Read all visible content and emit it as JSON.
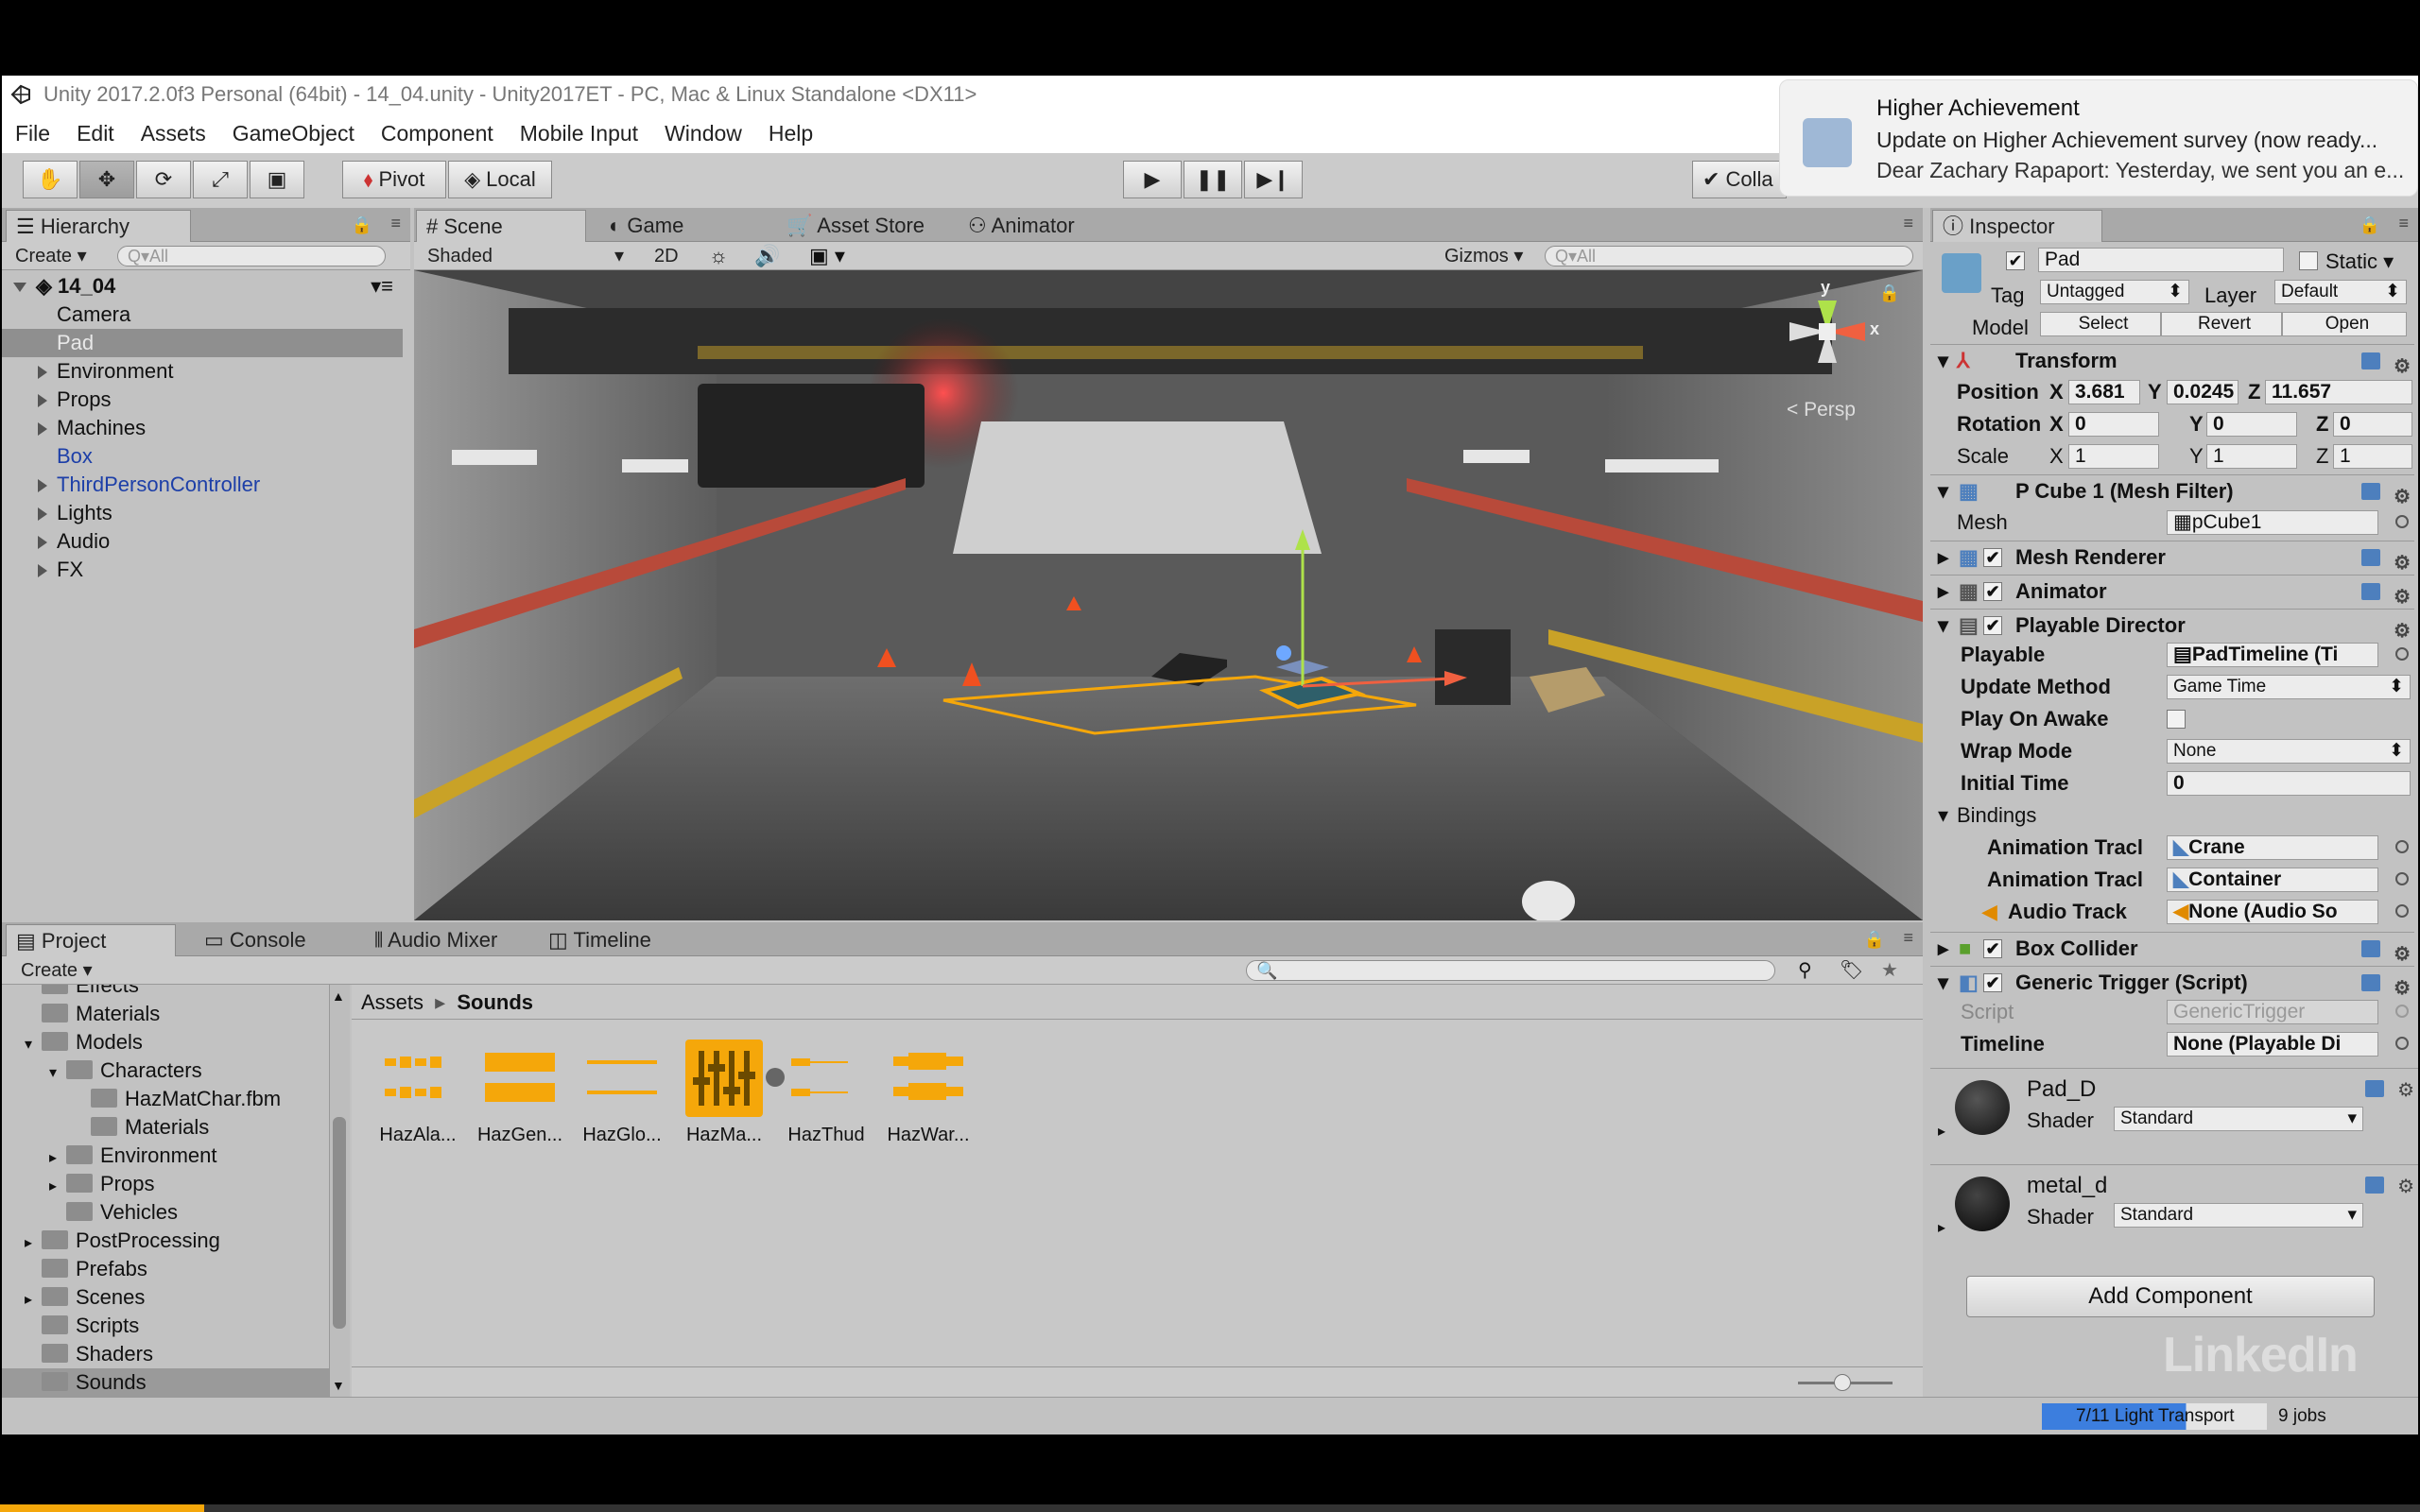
{
  "window": {
    "title": "Unity 2017.2.0f3 Personal (64bit) - 14_04.unity - Unity2017ET - PC, Mac & Linux Standalone <DX11>"
  },
  "menu": [
    "File",
    "Edit",
    "Assets",
    "GameObject",
    "Component",
    "Mobile Input",
    "Window",
    "Help"
  ],
  "toolbar": {
    "pivot": "Pivot",
    "local": "Local",
    "collab": "Colla"
  },
  "notification": {
    "title": "Higher Achievement",
    "subject": "Update on Higher Achievement survey (now ready...",
    "body": "Dear Zachary Rapaport: Yesterday, we sent you an e..."
  },
  "hierarchy": {
    "tab": "Hierarchy",
    "create": "Create",
    "search_placeholder": "Q▾All",
    "scene": "14_04",
    "items": [
      {
        "label": "Camera"
      },
      {
        "label": "Pad"
      },
      {
        "label": "Environment"
      },
      {
        "label": "Props"
      },
      {
        "label": "Machines"
      },
      {
        "label": "Box"
      },
      {
        "label": "ThirdPersonController"
      },
      {
        "label": "Lights"
      },
      {
        "label": "Audio"
      },
      {
        "label": "FX"
      }
    ]
  },
  "scene": {
    "tabs": [
      "Scene",
      "Game",
      "Asset Store",
      "Animator"
    ],
    "shading": "Shaded",
    "mode2d": "2D",
    "gizmos": "Gizmos",
    "search_placeholder": "Q▾All",
    "persp": "Persp",
    "axis_y": "y",
    "axis_x": "x"
  },
  "inspector": {
    "tab": "Inspector",
    "object_name": "Pad",
    "static": "Static",
    "tag_label": "Tag",
    "tag_value": "Untagged",
    "layer_label": "Layer",
    "layer_value": "Default",
    "model_label": "Model",
    "model_buttons": [
      "Select",
      "Revert",
      "Open"
    ],
    "transform": {
      "title": "Transform",
      "position_label": "Position",
      "rotation_label": "Rotation",
      "scale_label": "Scale",
      "position": [
        "3.681",
        "0.0245",
        "11.657"
      ],
      "rotation": [
        "0",
        "0",
        "0"
      ],
      "scale": [
        "1",
        "1",
        "1"
      ],
      "axes": [
        "X",
        "Y",
        "Z"
      ]
    },
    "mesh_filter": {
      "title": "P Cube 1 (Mesh Filter)",
      "mesh_label": "Mesh",
      "mesh_value": "pCube1"
    },
    "mesh_renderer": "Mesh Renderer",
    "animator": "Animator",
    "playable_director": {
      "title": "Playable Director",
      "playable_label": "Playable",
      "playable_value": "PadTimeline (Ti",
      "update_label": "Update Method",
      "update_value": "Game Time",
      "awake_label": "Play On Awake",
      "wrap_label": "Wrap Mode",
      "wrap_value": "None",
      "initial_label": "Initial Time",
      "initial_value": "0",
      "bindings_label": "Bindings",
      "bindings": [
        {
          "label": "Animation Tracl",
          "value": "Crane"
        },
        {
          "label": "Animation Tracl",
          "value": "Container"
        },
        {
          "label": "Audio Track",
          "value": "None (Audio So"
        }
      ]
    },
    "box_collider": "Box Collider",
    "generic_trigger": {
      "title": "Generic Trigger (Script)",
      "script_label": "Script",
      "script_value": "GenericTrigger",
      "timeline_label": "Timeline",
      "timeline_value": "None (Playable Di"
    },
    "materials": [
      {
        "name": "Pad_D",
        "shader_label": "Shader",
        "shader_value": "Standard"
      },
      {
        "name": "metal_d",
        "shader_label": "Shader",
        "shader_value": "Standard"
      }
    ],
    "add_component": "Add Component"
  },
  "project": {
    "tabs": [
      "Project",
      "Console",
      "Audio Mixer",
      "Timeline"
    ],
    "create": "Create",
    "tree": [
      {
        "label": "Effects",
        "indent": 1,
        "arrow": "none"
      },
      {
        "label": "Materials",
        "indent": 1,
        "arrow": "none"
      },
      {
        "label": "Models",
        "indent": 1,
        "arrow": "down"
      },
      {
        "label": "Characters",
        "indent": 2,
        "arrow": "down"
      },
      {
        "label": "HazMatChar.fbm",
        "indent": 3,
        "arrow": "none"
      },
      {
        "label": "Materials",
        "indent": 3,
        "arrow": "none"
      },
      {
        "label": "Environment",
        "indent": 2,
        "arrow": "right"
      },
      {
        "label": "Props",
        "indent": 2,
        "arrow": "right"
      },
      {
        "label": "Vehicles",
        "indent": 2,
        "arrow": "none"
      },
      {
        "label": "PostProcessing",
        "indent": 1,
        "arrow": "right"
      },
      {
        "label": "Prefabs",
        "indent": 1,
        "arrow": "none"
      },
      {
        "label": "Scenes",
        "indent": 1,
        "arrow": "right"
      },
      {
        "label": "Scripts",
        "indent": 1,
        "arrow": "none"
      },
      {
        "label": "Shaders",
        "indent": 1,
        "arrow": "none"
      },
      {
        "label": "Sounds",
        "indent": 1,
        "arrow": "none"
      }
    ],
    "breadcrumb": [
      "Assets",
      "Sounds"
    ],
    "assets": [
      {
        "label": "HazAla..."
      },
      {
        "label": "HazGen..."
      },
      {
        "label": "HazGlo..."
      },
      {
        "label": "HazMa..."
      },
      {
        "label": "HazThud"
      },
      {
        "label": "HazWar..."
      }
    ]
  },
  "status": {
    "progress_label": "7/11 Light Transport",
    "jobs": "9 jobs"
  },
  "watermark": "LinkedIn",
  "colors": {
    "accent_blue": "#3c7ede",
    "highlight_orange": "#f5a70a",
    "prefab_blue": "#1d3fa8"
  }
}
